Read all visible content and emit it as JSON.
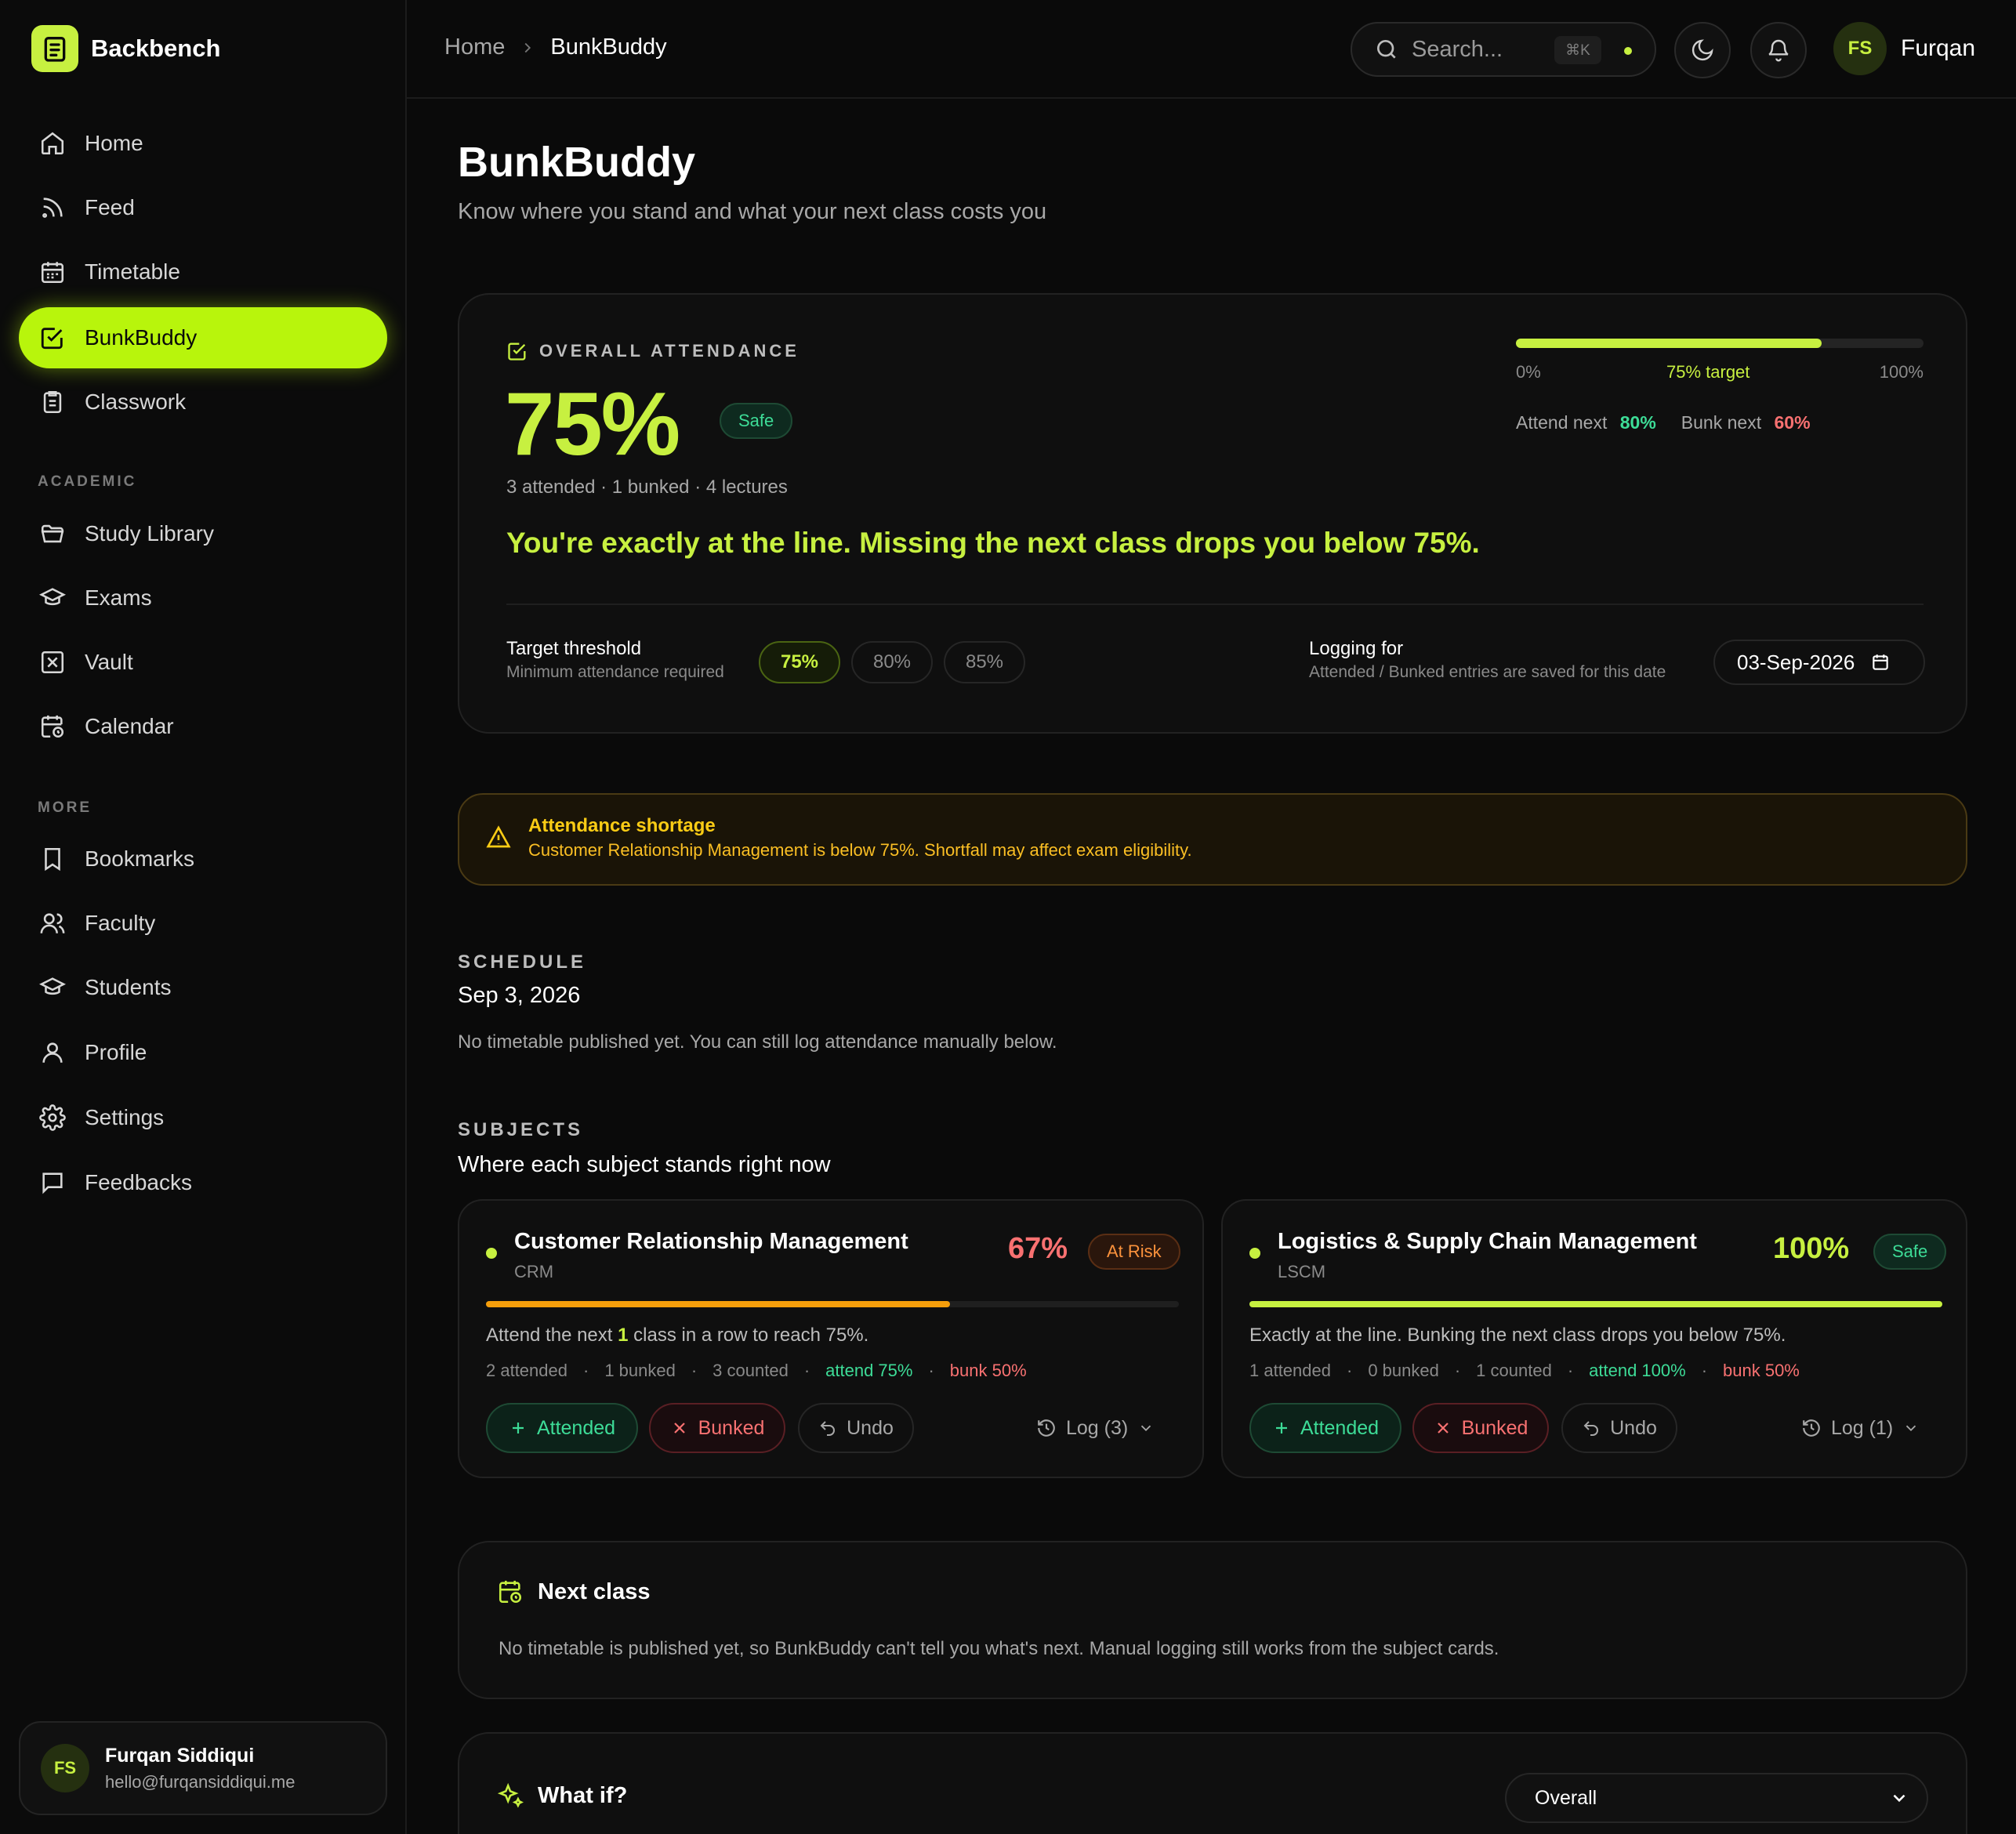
{
  "brand": {
    "name": "Backbench"
  },
  "sidebar": {
    "items": [
      {
        "label": "Home"
      },
      {
        "label": "Feed"
      },
      {
        "label": "Timetable"
      },
      {
        "label": "BunkBuddy"
      },
      {
        "label": "Classwork"
      }
    ],
    "academic_label": "ACADEMIC",
    "academic_items": [
      {
        "label": "Study Library"
      },
      {
        "label": "Exams"
      },
      {
        "label": "Vault"
      },
      {
        "label": "Calendar"
      }
    ],
    "more_label": "MORE",
    "more_items": [
      {
        "label": "Bookmarks"
      },
      {
        "label": "Faculty"
      },
      {
        "label": "Students"
      },
      {
        "label": "Profile"
      },
      {
        "label": "Settings"
      },
      {
        "label": "Feedbacks"
      }
    ],
    "user": {
      "initials": "FS",
      "name": "Furqan Siddiqui",
      "email": "hello@furqansiddiqui.me"
    }
  },
  "topbar": {
    "breadcrumb_home": "Home",
    "breadcrumb_current": "BunkBuddy",
    "search_placeholder": "Search...",
    "search_shortcut": "⌘K",
    "user_initials": "FS",
    "user_name": "Furqan"
  },
  "page": {
    "title": "BunkBuddy",
    "subtitle": "Know where you stand and what your next class costs you"
  },
  "overall": {
    "label": "OVERALL ATTENDANCE",
    "percent": "75%",
    "status": "Safe",
    "meta": "3 attended · 1 bunked · 4 lectures",
    "message": "You're exactly at the line. Missing the next class drops you below 75%.",
    "progress_fraction": 0.75,
    "scale_min": "0%",
    "scale_target": "75% target",
    "scale_max": "100%",
    "attend_next_label": "Attend next",
    "attend_next_value": "80%",
    "bunk_next_label": "Bunk next",
    "bunk_next_value": "60%",
    "threshold_title": "Target threshold",
    "threshold_sub": "Minimum attendance required",
    "threshold_options": [
      "75%",
      "80%",
      "85%"
    ],
    "threshold_selected": "75%",
    "logging_title": "Logging for",
    "logging_sub": "Attended / Bunked entries are saved for this date",
    "logging_date": "03-Sep-2026"
  },
  "alert": {
    "title": "Attendance shortage",
    "text": "Customer Relationship Management is below 75%. Shortfall may affect exam eligibility."
  },
  "schedule": {
    "label": "SCHEDULE",
    "date": "Sep 3, 2026",
    "note": "No timetable published yet. You can still log attendance manually below."
  },
  "subjects": {
    "label": "SUBJECTS",
    "title": "Where each subject stands right now",
    "list": [
      {
        "name": "Customer Relationship Management",
        "code": "CRM",
        "percent": "67%",
        "status": "At Risk",
        "fraction": 0.67,
        "msg_pre": "Attend the next ",
        "msg_num": "1",
        "msg_post": " class in a row to reach 75%.",
        "attended": "2 attended",
        "bunked": "1 bunked",
        "counted": "3 counted",
        "attend_stat": "attend 75%",
        "bunk_stat": "bunk 50%",
        "btn_attended": "Attended",
        "btn_bunked": "Bunked",
        "btn_undo": "Undo",
        "log": "Log (3)"
      },
      {
        "name": "Logistics & Supply Chain Management",
        "code": "LSCM",
        "percent": "100%",
        "status": "Safe",
        "fraction": 1.0,
        "msg": "Exactly at the line. Bunking the next class drops you below 75%.",
        "attended": "1 attended",
        "bunked": "0 bunked",
        "counted": "1 counted",
        "attend_stat": "attend 100%",
        "bunk_stat": "bunk 50%",
        "btn_attended": "Attended",
        "btn_bunked": "Bunked",
        "btn_undo": "Undo",
        "log": "Log (1)"
      }
    ]
  },
  "next_class": {
    "title": "Next class",
    "text": "No timetable is published yet, so BunkBuddy can't tell you what's next. Manual logging still works from the subject cards."
  },
  "what_if": {
    "title": "What if?",
    "select_value": "Overall"
  },
  "colors": {
    "accent": "#c7f040",
    "safe": "#3ddc97",
    "risk": "#fb923c",
    "danger": "#f87171",
    "warning": "#facc15"
  }
}
